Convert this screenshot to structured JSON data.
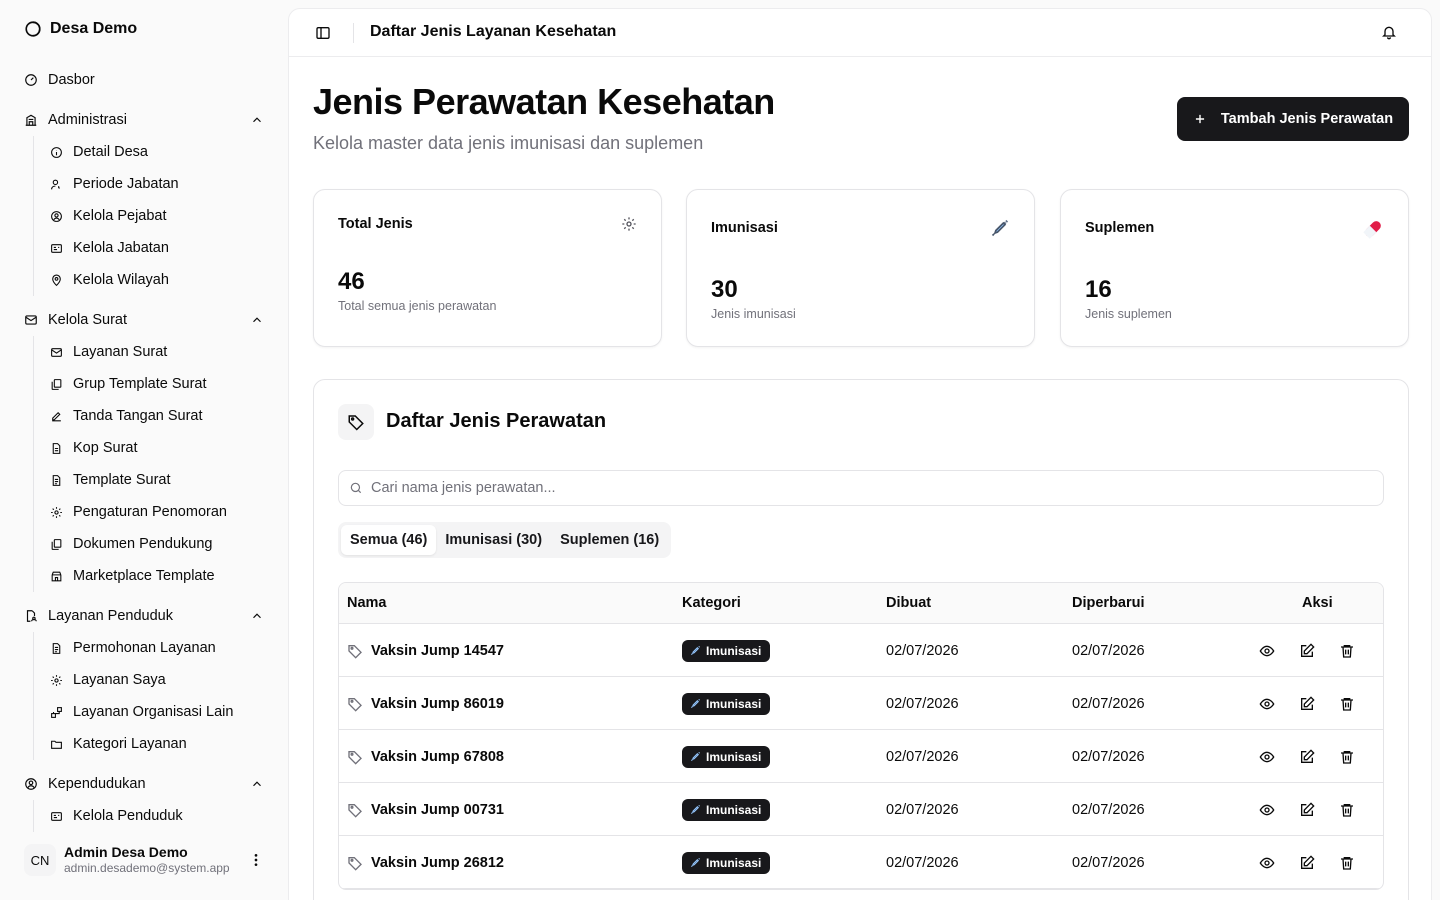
{
  "sidebar": {
    "brand": "Desa Demo",
    "dasbor": "Dasbor",
    "groups": [
      {
        "label": "Administrasi",
        "items": [
          "Detail Desa",
          "Periode Jabatan",
          "Kelola Pejabat",
          "Kelola Jabatan",
          "Kelola Wilayah"
        ]
      },
      {
        "label": "Kelola Surat",
        "items": [
          "Layanan Surat",
          "Grup Template Surat",
          "Tanda Tangan Surat",
          "Kop Surat",
          "Template Surat",
          "Pengaturan Penomoran",
          "Dokumen Pendukung",
          "Marketplace Template"
        ]
      },
      {
        "label": "Layanan Penduduk",
        "items": [
          "Permohonan Layanan",
          "Layanan Saya",
          "Layanan Organisasi Lain",
          "Kategori Layanan"
        ]
      },
      {
        "label": "Kependudukan",
        "items": [
          "Kelola Penduduk"
        ]
      }
    ],
    "user": {
      "initials": "CN",
      "name": "Admin Desa Demo",
      "email": "admin.desademo@system.app"
    }
  },
  "topbar": {
    "title": "Daftar Jenis Layanan Kesehatan"
  },
  "header": {
    "title": "Jenis Perawatan Kesehatan",
    "subtitle": "Kelola master data jenis imunisasi dan suplemen",
    "add_button": "Tambah Jenis Perawatan"
  },
  "stats": [
    {
      "label": "Total Jenis",
      "value": "46",
      "desc": "Total semua jenis perawatan",
      "icon": "gear-icon"
    },
    {
      "label": "Imunisasi",
      "value": "30",
      "desc": "Jenis imunisasi",
      "icon": "syringe-icon"
    },
    {
      "label": "Suplemen",
      "value": "16",
      "desc": "Jenis suplemen",
      "icon": "pill-icon"
    }
  ],
  "list": {
    "title": "Daftar Jenis Perawatan",
    "search_placeholder": "Cari nama jenis perawatan...",
    "tabs": [
      "Semua (46)",
      "Imunisasi (30)",
      "Suplemen (16)"
    ],
    "active_tab": 0,
    "columns": [
      "Nama",
      "Kategori",
      "Dibuat",
      "Diperbarui",
      "Aksi"
    ],
    "rows": [
      {
        "name": "Vaksin Jump 14547",
        "category": "Imunisasi",
        "created": "02/07/2026",
        "updated": "02/07/2026"
      },
      {
        "name": "Vaksin Jump 86019",
        "category": "Imunisasi",
        "created": "02/07/2026",
        "updated": "02/07/2026"
      },
      {
        "name": "Vaksin Jump 67808",
        "category": "Imunisasi",
        "created": "02/07/2026",
        "updated": "02/07/2026"
      },
      {
        "name": "Vaksin Jump 00731",
        "category": "Imunisasi",
        "created": "02/07/2026",
        "updated": "02/07/2026"
      },
      {
        "name": "Vaksin Jump 26812",
        "category": "Imunisasi",
        "created": "02/07/2026",
        "updated": "02/07/2026"
      }
    ]
  },
  "colors": {
    "primary": "#18181b",
    "muted": "#71717a",
    "border": "#e4e4e7",
    "pill": "#e11d48"
  }
}
